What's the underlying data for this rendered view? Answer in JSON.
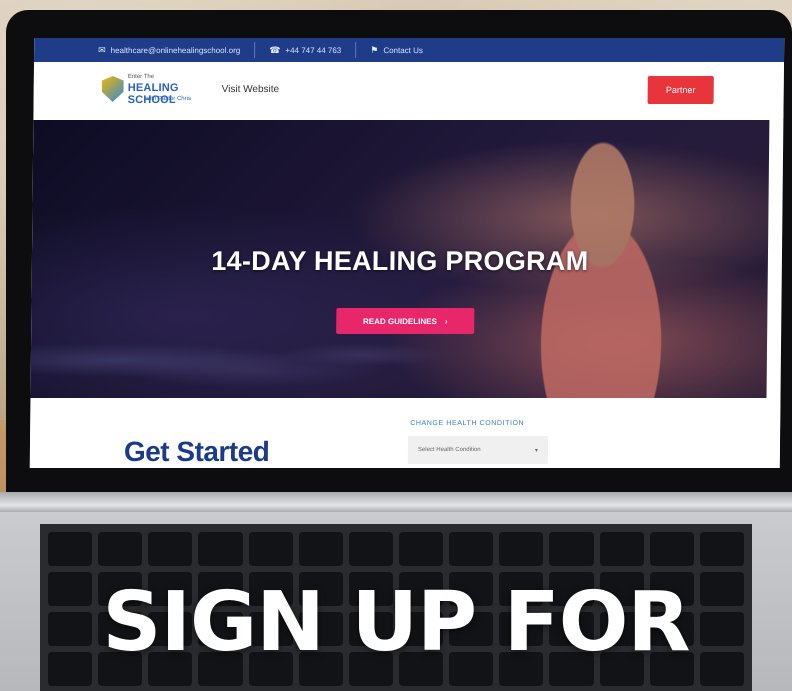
{
  "site": {
    "topbar": {
      "email": "healthcare@onlinehealingschool.org",
      "phone": "+44 747 44 763",
      "contact": "Contact Us"
    },
    "header": {
      "logo_small": "Enter The",
      "logo_main": "HEALING SCHOOL",
      "logo_sub": "with Pastor Chris",
      "visit": "Visit Website",
      "partner": "Partner"
    },
    "hero": {
      "title": "14-DAY HEALING PROGRAM",
      "cta": "READ GUIDELINES",
      "cta_icon": "chevron-right"
    },
    "lower": {
      "heading": "Get Started",
      "condition_label": "CHANGE HEALTH CONDITION",
      "condition_placeholder": "Select Health Condition"
    }
  },
  "overlay": {
    "headline": "SIGN UP FOR"
  },
  "colors": {
    "topbar": "#1f3c88",
    "partner": "#e8343b",
    "cta": "#e8276b",
    "heading": "#1b3a8c"
  }
}
